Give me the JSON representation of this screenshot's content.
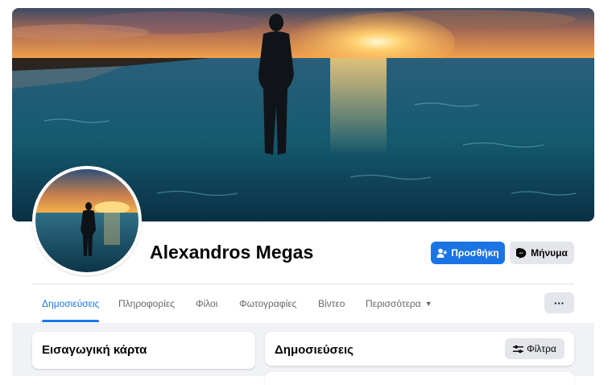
{
  "profile": {
    "name": "Alexandros Megas"
  },
  "actions": {
    "add_label": "Προσθήκη",
    "add_icon": "add-friend-icon",
    "message_label": "Μήνυμα",
    "message_icon": "messenger-icon",
    "more_label": "···"
  },
  "tabs": [
    {
      "label": "Δημοσιεύσεις",
      "active": true
    },
    {
      "label": "Πληροφορίες"
    },
    {
      "label": "Φίλοι"
    },
    {
      "label": "Φωτογραφίες"
    },
    {
      "label": "Βίντεο"
    },
    {
      "label": "Περισσότερα",
      "icon": "caret-down-icon"
    }
  ],
  "intro": {
    "title": "Εισαγωγική κάρτα"
  },
  "posts": {
    "title": "Δημοσιεύσεις",
    "filter_label": "Φίλτρα",
    "filter_icon": "filter-sliders-icon"
  },
  "colors": {
    "accent": "#1877f2",
    "primary_button": "#1b74e4",
    "secondary_button": "#e4e6eb",
    "page_background": "#f0f2f5"
  }
}
